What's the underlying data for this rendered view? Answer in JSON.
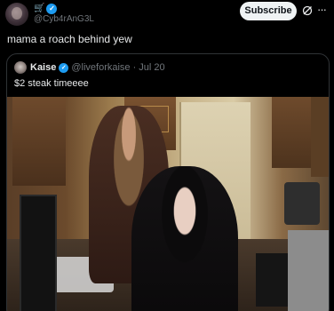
{
  "post": {
    "author_handle": "@Cyb4rAnG3L",
    "author_name_glyph": "🛒",
    "subscribe_label": "Subscribe",
    "text": "mama a roach behind yew"
  },
  "quoted": {
    "name": "Kaise",
    "handle": "@liveforkaise",
    "separator": "·",
    "date": "Jul 20",
    "text": "$2 steak timeeee"
  },
  "icons": {
    "verified": "verified-badge-icon",
    "grok": "grok-icon",
    "more": "more-icon"
  },
  "colors": {
    "background": "#000000",
    "verified": "#1d9bf0",
    "muted": "#71767b",
    "text": "#e7e9ea"
  }
}
